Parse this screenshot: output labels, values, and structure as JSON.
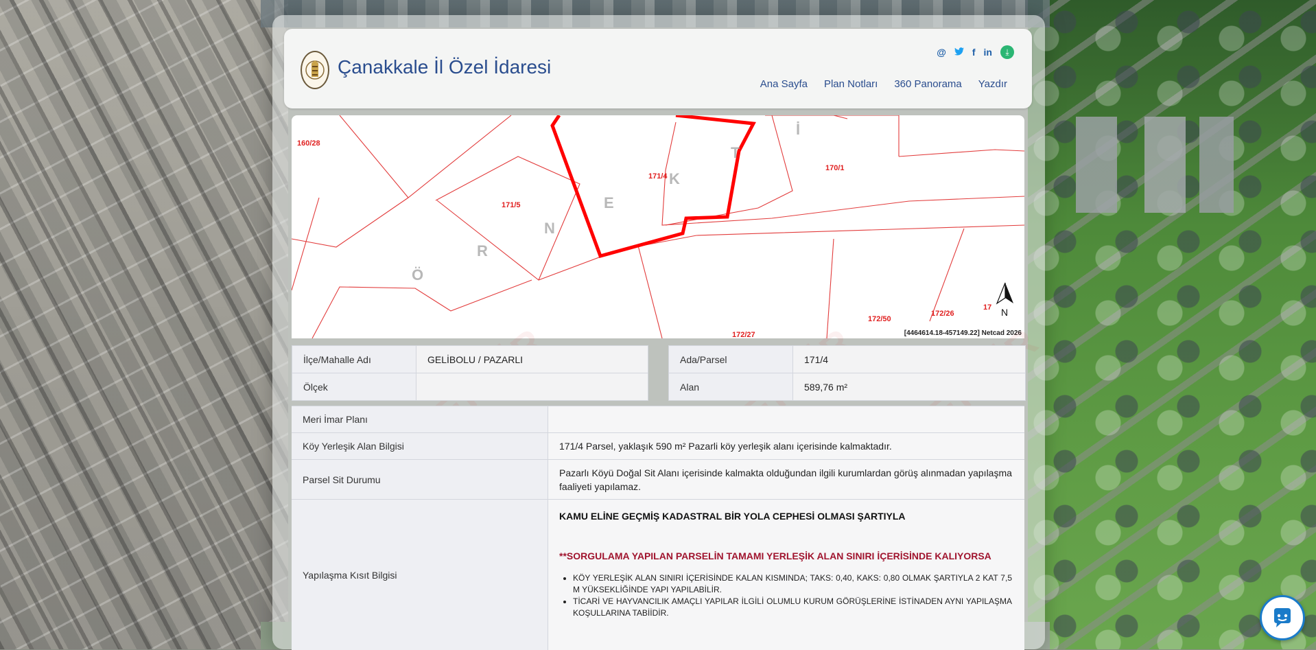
{
  "header": {
    "title": "Çanakkale İl Özel İdaresi",
    "social": [
      "@",
      "twitter",
      "f",
      "in"
    ],
    "nav": [
      "Ana Sayfa",
      "Plan Notları",
      "360 Panorama",
      "Yazdır"
    ]
  },
  "map": {
    "parcel_labels": [
      "160/28",
      "171/5",
      "171/4",
      "170/1",
      "172/50",
      "172/26",
      "172/27",
      "17"
    ],
    "watermark_letters": [
      "Ö",
      "R",
      "N",
      "E",
      "K",
      "T",
      "İ"
    ],
    "coords": "[4464614.18-457149.22] Netcad 2026",
    "north_label": "N"
  },
  "info_left": [
    {
      "label": "İlçe/Mahalle Adı",
      "value": "GELİBOLU / PAZARLI"
    },
    {
      "label": "Ölçek",
      "value": ""
    }
  ],
  "info_right": [
    {
      "label": "Ada/Parsel",
      "value": "171/4"
    },
    {
      "label": "Alan",
      "value": "589,76 m²"
    }
  ],
  "details": {
    "meri_label": "Meri İmar Planı",
    "meri_value": "",
    "koy_label": "Köy Yerleşik Alan Bilgisi",
    "koy_value": "171/4 Parsel, yaklaşık 590 m² Pazarli köy yerleşik alanı içerisinde kalmaktadır.",
    "sit_label": "Parsel Sit Durumu",
    "sit_value": "Pazarlı Köyü Doğal Sit Alanı içerisinde kalmakta olduğundan ilgili kurumlardan görüş alınmadan yapılaşma faaliyeti yapılamaz.",
    "kisit_label": "Yapılaşma Kısıt Bilgisi",
    "kisit_h1": "KAMU ELİNE GEÇMİŞ KADASTRAL BİR YOLA CEPHESİ OLMASI ŞARTIYLA",
    "kisit_h2": "**SORGULAMA YAPILAN PARSELİN TAMAMI YERLEŞİK ALAN SINIRI İÇERİSİNDE KALIYORSA",
    "kisit_items": [
      "KÖY YERLEŞİK ALAN SINIRI İÇERİSİNDE KALAN KISMINDA; TAKS: 0,40, KAKS: 0,80 OLMAK ŞARTIYLA 2 KAT 7,5 M YÜKSEKLİĞİNDE YAPI YAPILABİLİR.",
      "TİCARİ VE HAYVANCILIK AMAÇLI YAPILAR İLGİLİ OLUMLU KURUM GÖRÜŞLERİNE İSTİNADEN AYNI YAPILAŞMA KOŞULLARINA TABİİDİR."
    ]
  },
  "watermark_text": "ÖRNEKTİR"
}
